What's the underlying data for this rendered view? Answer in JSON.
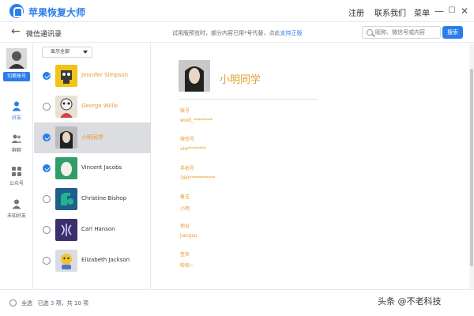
{
  "app": {
    "title": "苹果恢复大师"
  },
  "top_menu": {
    "register": "注册",
    "contact": "联系我们",
    "menu": "菜单"
  },
  "window": {
    "minimize": "—",
    "maximize": "☐",
    "close": "✕"
  },
  "header": {
    "title": "微信通讯录",
    "trial_text": "试用版预览时，部分内容已用*号代替，点此",
    "trial_link": "支持正版",
    "search_placeholder": "昵称、微信号或内容",
    "search_button": "搜索"
  },
  "leftnav": {
    "switch_account": "切换账号",
    "items": [
      {
        "label": "好友",
        "active": true
      },
      {
        "label": "群聊",
        "active": false
      },
      {
        "label": "公众号",
        "active": false
      },
      {
        "label": "未知好友",
        "active": false
      }
    ]
  },
  "list": {
    "filter": "显示全部",
    "contacts": [
      {
        "name": "Jennifer Simpson",
        "checked": true,
        "highlight": true
      },
      {
        "name": "George Willis",
        "checked": false,
        "highlight": true
      },
      {
        "name": "小明同学",
        "checked": true,
        "highlight": true
      },
      {
        "name": "Vincent Jacobs",
        "checked": true,
        "highlight": false
      },
      {
        "name": "Christine Bishop",
        "checked": false,
        "highlight": false
      },
      {
        "name": "Carl Hanson",
        "checked": false,
        "highlight": false
      },
      {
        "name": "Elizabeth Jackson",
        "checked": false,
        "highlight": false
      }
    ]
  },
  "detail": {
    "name": "小明同学",
    "fields": [
      {
        "label": "账号",
        "value": "wxid_********"
      },
      {
        "label": "微信号",
        "value": "xia********"
      },
      {
        "label": "手机号",
        "value": "180***********"
      },
      {
        "label": "备注",
        "value": "小明"
      },
      {
        "label": "地址",
        "value": "jiangsu"
      },
      {
        "label": "签名",
        "value": "哈哈~"
      }
    ]
  },
  "footer": {
    "select_all": "全选",
    "selected_prefix": "已选",
    "selected_count": "3",
    "selected_mid": "项，共",
    "total": "10",
    "total_suffix": "项"
  },
  "watermark": "头条 @不老科技",
  "colors": {
    "accent": "#2b7de9",
    "highlight": "#e59a2e"
  }
}
